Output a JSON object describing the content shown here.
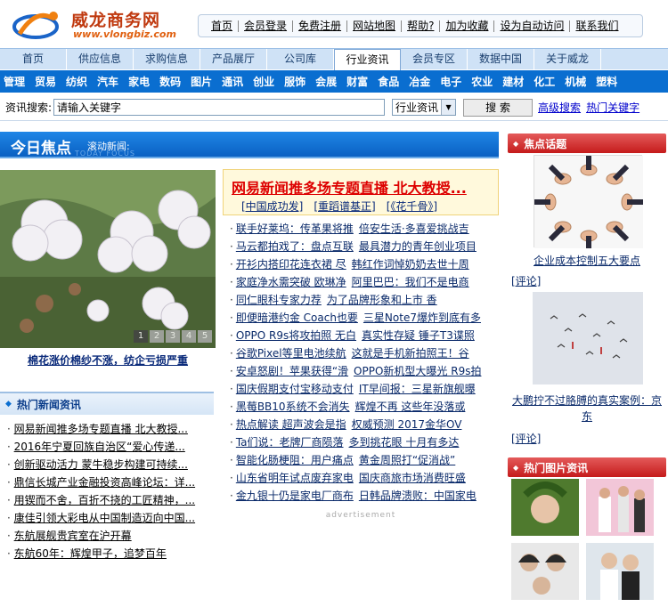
{
  "logo": {
    "name_cn": "威龙商务网",
    "url": "www.vlongbiz.com"
  },
  "top_links": [
    "首页",
    "会员登录",
    "免费注册",
    "网站地图",
    "帮助?",
    "加为收藏",
    "设为自动访问",
    "联系我们"
  ],
  "nav_tabs": [
    {
      "label": "首页",
      "active": false
    },
    {
      "label": "供应信息",
      "active": false
    },
    {
      "label": "求购信息",
      "active": false
    },
    {
      "label": "产品展厅",
      "active": false
    },
    {
      "label": "公司库",
      "active": false
    },
    {
      "label": "行业资讯",
      "active": true
    },
    {
      "label": "会员专区",
      "active": false
    },
    {
      "label": "数据中国",
      "active": false
    },
    {
      "label": "关于威龙",
      "active": false
    }
  ],
  "categories": [
    "管理",
    "贸易",
    "纺织",
    "汽车",
    "家电",
    "数码",
    "图片",
    "通讯",
    "创业",
    "服饰",
    "会展",
    "财富",
    "食品",
    "冶金",
    "电子",
    "农业",
    "建材",
    "化工",
    "机械",
    "塑料"
  ],
  "search": {
    "label": "资讯搜索:",
    "value": "请输入关键字",
    "select_value": "行业资讯",
    "button": "搜 索",
    "advanced": "高级搜索",
    "hot_keywords": "热门关键字"
  },
  "focus": {
    "title": "今日焦点",
    "scroll_label": "滚动新闻:",
    "english": "TODAY FOCUS"
  },
  "slideshow": {
    "pages": [
      "1",
      "2",
      "3",
      "4",
      "5"
    ],
    "current": "1",
    "caption": "棉花涨价棉纱不涨，纺企亏损严重"
  },
  "hot_news": {
    "title": "热门新闻资讯",
    "items": [
      "网易新闻推多场专题直播 北大教授...",
      "2016年宁夏回族自治区“爱心传递...",
      "创新驱动活力 蒙牛稳步构建可持续...",
      "鼎信长城产业金融投资高峰论坛：详...",
      "用锲而不舍，百折不挠的工匠精神，...",
      "康佳引领大彩电从中国制造迈向中国...",
      "东航展舰贵宾室在沪开幕",
      "东航60年：辉煌甲子，追梦百年"
    ]
  },
  "headline": {
    "title": "网易新闻推多场专题直播 北大教授...",
    "subs": [
      "[中国成功发]",
      "[重蹈谱基正]",
      "[《花千骨》]"
    ]
  },
  "news": [
    [
      "联手好莱坞：传革果将推",
      "倍安生活·多喜爱挑战吉"
    ],
    [
      "马云都拍戏了：盘点互联",
      "最具潜力的青年创业项目"
    ],
    [
      "开衫内搭印花连衣裙 尽",
      "韩红作词悼奶奶去世十周"
    ],
    [
      "家庭净水需突破 欧琳净",
      "阿里巴巴：我们不是电商"
    ],
    [
      "同仁眼科专家力荐",
      "为了品牌形象和上市 香"
    ],
    [
      "即便暗港约金 Coach也要",
      "三星Note7爆炸到底有多"
    ],
    [
      "OPPO R9s将攻拍照 无白",
      "真实性存疑 锤子T3谍照"
    ],
    [
      "谷歌Pixel等里电池续航",
      "这就是手机新拍照王！谷"
    ],
    [
      "安卓怒剧！苹果获得“滑",
      "OPPO新机型大曝光 R9s拍"
    ],
    [
      "国庆假期支付宝移动支付",
      "IT早间报：三星新旗舰曝"
    ],
    [
      "黑莓BB10系统不会消失",
      "辉煌不再 这些年没落或"
    ],
    [
      "热点解读 超声波会是指",
      "权威预测 2017金华OV"
    ],
    [
      "Ta们说：老牌厂商陨落",
      "多到挑花眼 十月有多达"
    ],
    [
      "智能化肠梗阻：用户痛点",
      "黄金周照打“促消战”"
    ],
    [
      "山东省明年试点废弃家电",
      "国庆商旅市场消费旺盛"
    ],
    [
      "金九银十仍是家电厂商布",
      "日韩品牌溃败：中国家电"
    ]
  ],
  "advertisement": "advertisement",
  "focus_topics": {
    "title": "焦点话题",
    "items": [
      {
        "caption": "企业成本控制五大要点",
        "comment": "[评论]"
      },
      {
        "caption": "大鹏拧不过胳膊的真实案例：京东",
        "comment": "[评论]"
      }
    ]
  },
  "hot_pictures": {
    "title": "热门图片资讯"
  },
  "colors": {
    "nav_bg": "#cfe2f6",
    "category_bar": "#0a6ed0",
    "focus_bar": "#0a60c2",
    "right_header": "#c51b1b",
    "headline_red": "#dd0000"
  }
}
